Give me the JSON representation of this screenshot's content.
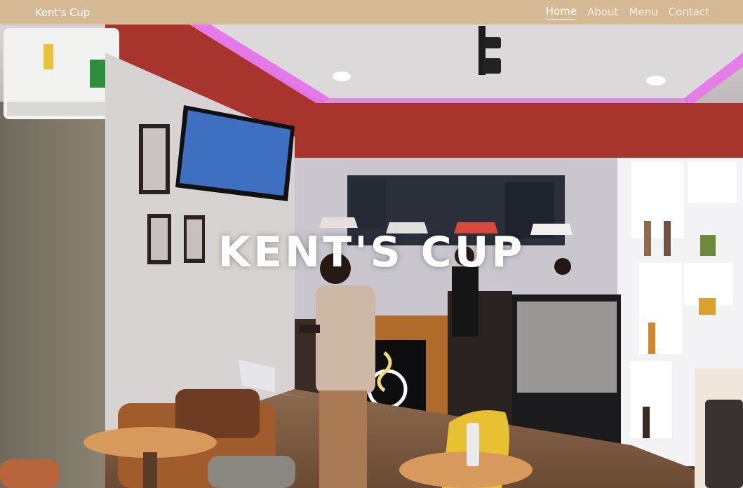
{
  "nav": {
    "brand": "Kent's Cup",
    "links": [
      {
        "label": "Home",
        "active": true
      },
      {
        "label": "About",
        "active": false
      },
      {
        "label": "Menu",
        "active": false
      },
      {
        "label": "Contact",
        "active": false
      }
    ]
  },
  "hero": {
    "title": "KENT'S CUP"
  },
  "colors": {
    "navbar": "#d5b994",
    "nav_text": "#ffffff",
    "ceiling_glow": "#e46ee8",
    "wall_red": "#a8352d"
  }
}
